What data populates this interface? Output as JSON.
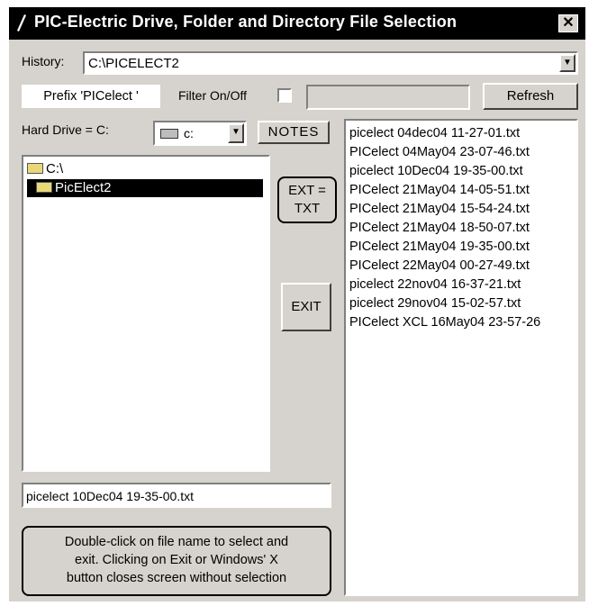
{
  "window": {
    "title": "PIC-Electric  Drive, Folder and Directory File Selection",
    "close_symbol": "✕"
  },
  "history": {
    "label": "History:",
    "value": "C:\\PICELECT2"
  },
  "prefix": {
    "label": "Prefix 'PICelect '"
  },
  "filter": {
    "label": "Filter On/Off",
    "checked": false,
    "value": ""
  },
  "refresh_button": "Refresh",
  "drive": {
    "label": "Hard Drive = C:",
    "selected": "c:"
  },
  "notes_button": "NOTES",
  "ext_button": {
    "line1": "EXT =",
    "line2": "TXT"
  },
  "exit_button": "EXIT",
  "folders": [
    {
      "label": "C:\\",
      "selected": false
    },
    {
      "label": "PicElect2",
      "selected": true
    }
  ],
  "files": [
    "picelect 04dec04 11-27-01.txt",
    "PICelect 04May04 23-07-46.txt",
    "picelect 10Dec04 19-35-00.txt",
    "PICelect 21May04 14-05-51.txt",
    "PICelect 21May04 15-54-24.txt",
    "PICelect 21May04 18-50-07.txt",
    "PICelect 21May04 19-35-00.txt",
    "PICelect 22May04 00-27-49.txt",
    "picelect 22nov04 16-37-21.txt",
    "picelect 29nov04 15-02-57.txt",
    "PICelect XCL 16May04 23-57-26"
  ],
  "selected_file": "picelect 10Dec04 19-35-00.txt",
  "help": {
    "line1": "Double-click on file name to select and",
    "line2": "exit. Clicking on Exit or Windows' X",
    "line3": "button closes screen without selection"
  }
}
